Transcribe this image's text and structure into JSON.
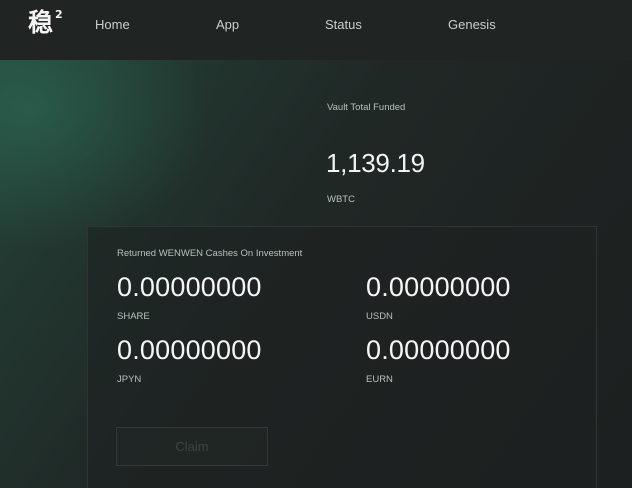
{
  "header": {
    "logo_text": "稳",
    "logo_superscript": "2",
    "nav": [
      {
        "label": "Home"
      },
      {
        "label": "App"
      },
      {
        "label": "Status"
      },
      {
        "label": "Genesis"
      }
    ]
  },
  "vault": {
    "label": "Vault Total Funded",
    "value": "1,139.19",
    "unit": "WBTC"
  },
  "returns": {
    "title": "Returned WENWEN Cashes On Investment",
    "items": [
      {
        "amount": "0.00000000",
        "unit": "SHARE"
      },
      {
        "amount": "0.00000000",
        "unit": "USDN"
      },
      {
        "amount": "0.00000000",
        "unit": "JPYN"
      },
      {
        "amount": "0.00000000",
        "unit": "EURN"
      }
    ],
    "claim_label": "Claim"
  },
  "colors": {
    "background": "#1f2423",
    "accent_glow": "#2e7058",
    "text_primary": "#f4f6f5",
    "text_secondary": "#b8c0bc"
  }
}
